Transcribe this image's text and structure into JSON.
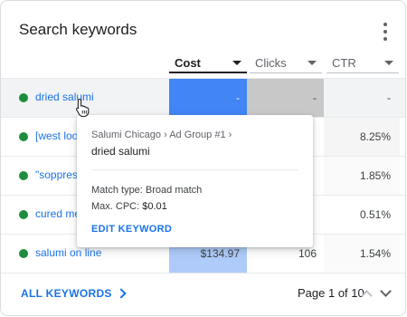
{
  "card": {
    "title": "Search keywords"
  },
  "columns": [
    {
      "label": "Cost",
      "sorted": true
    },
    {
      "label": "Clicks",
      "sorted": false
    },
    {
      "label": "CTR",
      "sorted": false
    }
  ],
  "rows": [
    {
      "keyword": "dried salumi",
      "cost": "-",
      "clicks": "-",
      "ctr": "-"
    },
    {
      "keyword": "[west loo",
      "cost": "",
      "clicks": "",
      "ctr": "8.25%"
    },
    {
      "keyword": "\"soppress",
      "cost": "",
      "clicks": "",
      "ctr": "1.85%"
    },
    {
      "keyword": "cured me",
      "cost": "",
      "clicks": "",
      "ctr": "0.51%"
    },
    {
      "keyword": "salumi on line",
      "cost": "$134.97",
      "clicks": "106",
      "ctr": "1.54%"
    }
  ],
  "tooltip": {
    "path": "Salumi Chicago › Ad Group #1 ›",
    "keyword": "dried salumi",
    "match_type_label": "Match type:",
    "match_type_value": "Broad match",
    "max_cpc_label": "Max. CPC:",
    "max_cpc_value": "$0.01",
    "edit_label": "EDIT KEYWORD"
  },
  "footer": {
    "all_keywords_label": "ALL KEYWORDS",
    "page_label": "Page 1 of 10"
  },
  "icons": {
    "menu": "more-vert-icon",
    "status": "status-dot-icon",
    "sort": "caret-down-icon",
    "next": "chevron-right-icon",
    "page_up": "chevron-up-icon",
    "page_down": "chevron-down-icon",
    "cursor": "hand-pointer-icon"
  },
  "colors": {
    "accent": "#1a73e8",
    "status_green": "#1e8e3e",
    "cost_highlight": "#4285f4",
    "cost_light": "#aecbfa",
    "clicks_highlight": "#c8c8c8"
  }
}
